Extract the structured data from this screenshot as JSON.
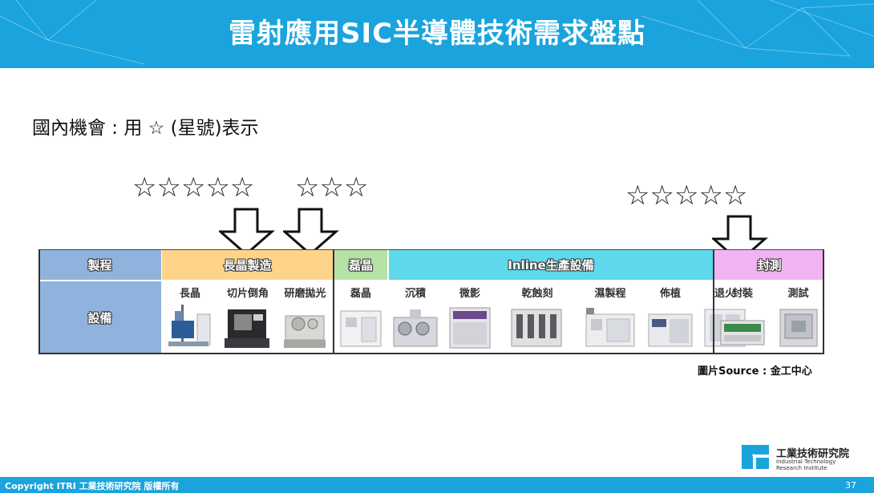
{
  "header": {
    "title": "雷射應用SIC半導體技術需求盤點"
  },
  "subtitle": "國內機會 : 用 ☆ (星號)表示",
  "star_groups": [
    {
      "stars": "☆☆☆☆☆",
      "rating": 5
    },
    {
      "stars": "☆☆☆",
      "rating": 3
    },
    {
      "stars": "☆☆☆☆☆",
      "rating": 5
    }
  ],
  "table": {
    "row_labels": {
      "process": "製程",
      "equipment": "設備"
    },
    "categories": [
      {
        "label": "長晶製造",
        "color": "#fdd48a"
      },
      {
        "label": "磊晶",
        "color": "#b5e3a5"
      },
      {
        "label": "Inline生產設備",
        "color": "#5ed8ea"
      },
      {
        "label": "封測",
        "color": "#f2b3f2"
      }
    ],
    "equipment": [
      "長晶",
      "切片倒角",
      "研磨拋光",
      "磊晶",
      "沉積",
      "微影",
      "乾蝕刻",
      "濕製程",
      "佈植",
      "退火",
      "封裝",
      "測試"
    ],
    "left_color": "#8fb3dc"
  },
  "source": "圖片Source : 金工中心",
  "logo": {
    "name": "工業技術研究院",
    "english": "Industrial Technology Research Institute"
  },
  "footer": {
    "copyright": "Copyright ITRI 工業技術研究院 版權所有",
    "page": "37"
  }
}
